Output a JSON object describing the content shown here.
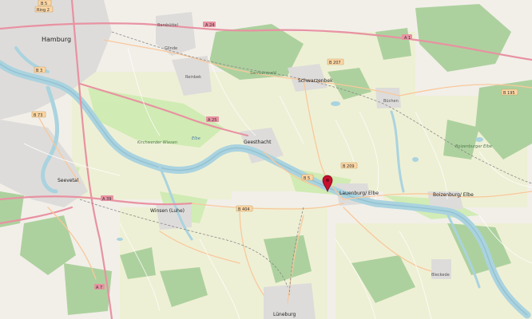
{
  "map": {
    "marker_color": "#c8102e",
    "colors": {
      "land": "#f2efe9",
      "farmland": "#eef0d5",
      "forest": "#add19e",
      "meadow": "#cdebb0",
      "water": "#aad3df",
      "urban": "#e0dfdf",
      "motorway": "#e892a2",
      "trunk": "#f9b29c",
      "primary": "#fcd6a4"
    },
    "places": {
      "hamburg": "Hamburg",
      "barsbuettel": "Barsbüttel",
      "glinde": "Glinde",
      "reinbek": "Reinbek",
      "sachsenwald": "Sachsenwald",
      "schwarzenbek": "Schwarzenbek",
      "buechen": "Büchen",
      "geesthacht": "Geesthacht",
      "lauenburg": "Lauenburg/ Elbe",
      "boizenburg": "Boizenburg/ Elbe",
      "seevetal": "Seevetal",
      "winsen": "Winsen (Luhe)",
      "bleckede": "Bleckede",
      "lueneburg": "Lüneburg",
      "kirchwerder": "Kirchwerder Wiesen",
      "elbe": "Elbe",
      "boizenburger": "Boizenburger Elbe"
    },
    "roads": {
      "b5_top": "B 5",
      "ring2": "Ring 2",
      "a24": "A 24",
      "a1": "A 1",
      "b3": "B 3",
      "b73": "B 73",
      "a25": "A 25",
      "b207": "B 207",
      "b195": "B 195",
      "b5_mid": "B 5",
      "b209": "B 209",
      "a39": "A 39",
      "b404": "B 404",
      "a7": "A 7"
    }
  }
}
